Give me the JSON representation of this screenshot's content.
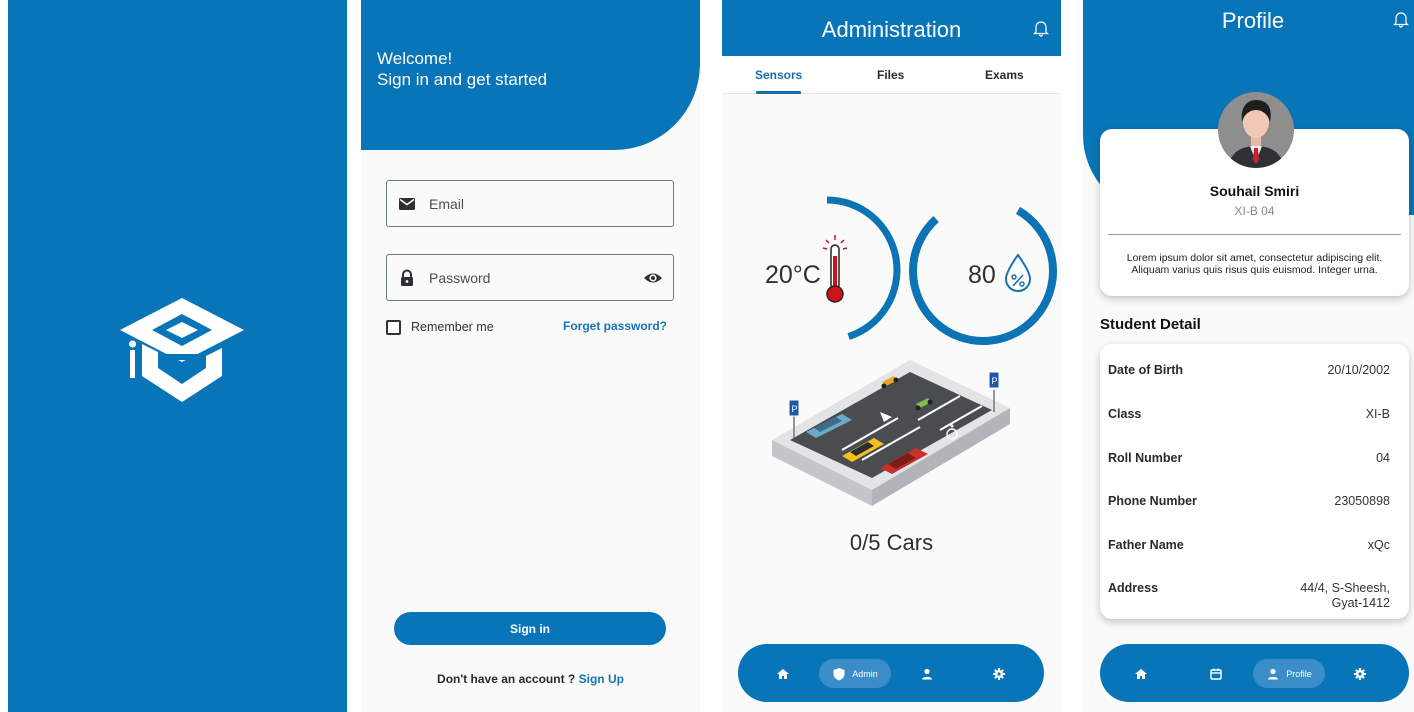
{
  "colors": {
    "primary": "#0875b8",
    "accent": "#1676b3",
    "background": "#fafafa"
  },
  "login": {
    "welcome_line1": "Welcome!",
    "welcome_line2": "Sign in and get started",
    "email_placeholder": "Email",
    "password_placeholder": "Password",
    "remember_label": "Remember me",
    "forgot_label": "Forget password?",
    "signin_label": "Sign in",
    "no_account_text": "Don't have an account ?",
    "signup_label": "Sign Up",
    "icons": {
      "email": "envelope-icon",
      "password": "lock-icon",
      "visibility": "eye-icon"
    }
  },
  "admin": {
    "title": "Administration",
    "tabs": [
      {
        "label": "Sensors",
        "active": true
      },
      {
        "label": "Files",
        "active": false
      },
      {
        "label": "Exams",
        "active": false
      }
    ],
    "temperature": {
      "text": "20°C",
      "gauge_fraction": 0.45
    },
    "humidity": {
      "text": "80",
      "gauge_fraction": 0.8
    },
    "cars_text": "0/5 Cars",
    "nav": [
      {
        "icon": "home-icon",
        "label": ""
      },
      {
        "icon": "shield-icon",
        "label": "Admin",
        "active": true
      },
      {
        "icon": "person-icon",
        "label": ""
      },
      {
        "icon": "gear-icon",
        "label": ""
      }
    ]
  },
  "profile": {
    "title": "Profile",
    "name": "Souhail Smiri",
    "class_label": "XI-B 04",
    "bio": "Lorem ipsum dolor sit amet, consectetur adipiscing elit. Aliquam varius quis risus quis euismod. Integer urna.",
    "section_title": "Student Detail",
    "details": [
      {
        "label": "Date of Birth",
        "value": "20/10/2002"
      },
      {
        "label": "Class",
        "value": "XI-B"
      },
      {
        "label": "Roll Number",
        "value": "04"
      },
      {
        "label": "Phone Number",
        "value": "23050898"
      },
      {
        "label": "Father Name",
        "value": "xQc"
      },
      {
        "label": "Address",
        "value": "44/4, S-Sheesh, Gyat-1412"
      }
    ],
    "nav": [
      {
        "icon": "home-icon",
        "label": ""
      },
      {
        "icon": "calendar-icon",
        "label": ""
      },
      {
        "icon": "person-icon",
        "label": "Profile",
        "active": true
      },
      {
        "icon": "gear-icon",
        "label": ""
      }
    ]
  }
}
